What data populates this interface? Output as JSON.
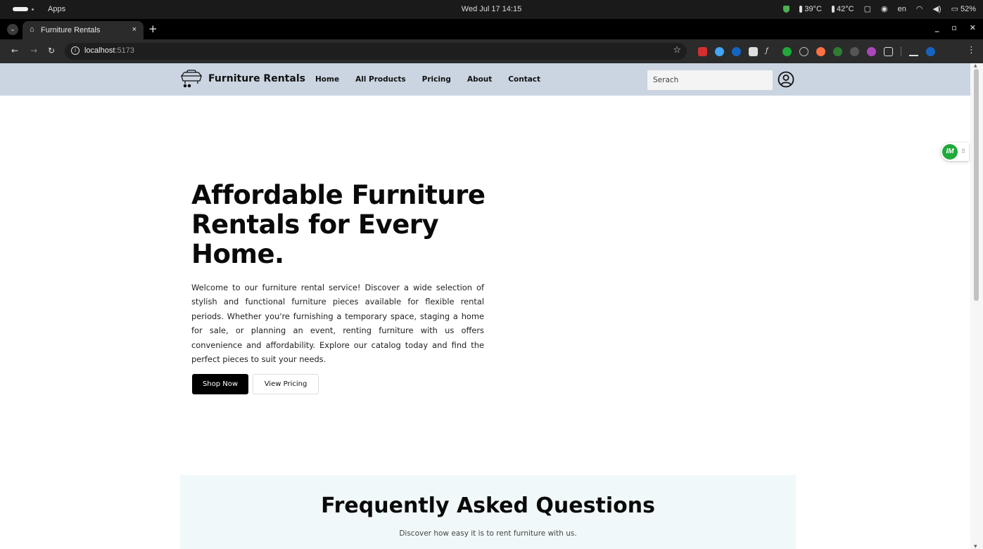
{
  "os": {
    "apps_label": "Apps",
    "datetime": "Wed Jul 17  14:15",
    "temp1": "39°C",
    "temp2": "42°C",
    "lang": "en",
    "battery": "52%"
  },
  "browser": {
    "tab_title": "Furniture Rentals",
    "tab_close": "×",
    "new_tab": "+",
    "url_host": "localhost",
    "url_port": ":5173"
  },
  "site": {
    "brand": "Furniture Rentals",
    "nav": [
      "Home",
      "All Products",
      "Pricing",
      "About",
      "Contact"
    ],
    "search_placeholder": "Serach",
    "colors": {
      "nav_bg": "#cbd5e1",
      "faq_bg": "#f1f8f9",
      "primary_btn": "#000000",
      "widget_green": "#1faa3b"
    }
  },
  "hero": {
    "title": "Affordable Furniture Rentals for Every Home.",
    "text": "Welcome to our furniture rental service! Discover a wide selection of stylish and functional furniture pieces available for flexible rental periods. Whether you're furnishing a temporary space, staging a home for sale, or planning an event, renting furniture with us offers convenience and affordability. Explore our catalog today and find the perfect pieces to suit your needs.",
    "shop_button": "Shop Now",
    "pricing_button": "View Pricing"
  },
  "faq": {
    "title": "Frequently Asked Questions",
    "subtitle": "Discover how easy it is to rent furniture with us."
  },
  "widget": {
    "badge": "IM"
  }
}
